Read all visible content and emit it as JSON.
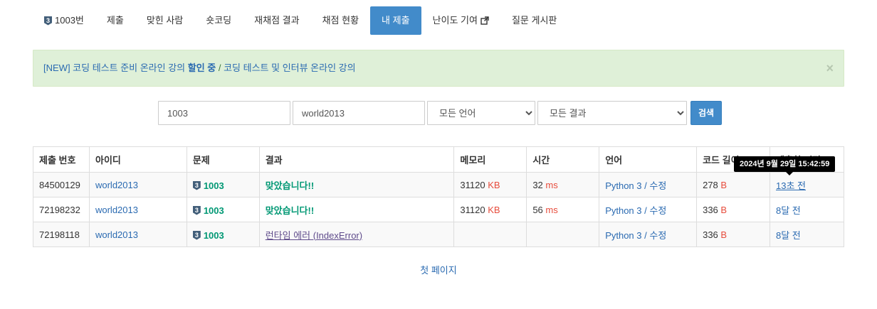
{
  "nav": {
    "problem_badge": "3",
    "problem_label": "1003번",
    "items": [
      "제출",
      "맞힌 사람",
      "숏코딩",
      "재채점 결과",
      "채점 현황",
      "내 제출",
      "난이도 기여",
      "질문 게시판"
    ]
  },
  "alert": {
    "prefix": "[NEW] 코딩 테스트 준비 온라인 강의 ",
    "bold": "할인 중",
    "sep": " / ",
    "link2": "코딩 테스트 및 인터뷰 온라인 강의",
    "close": "×"
  },
  "search": {
    "problem_id": "1003",
    "user_id": "world2013",
    "language": "모든 언어",
    "result": "모든 결과",
    "button": "검색"
  },
  "table": {
    "headers": [
      "제출 번호",
      "아이디",
      "문제",
      "결과",
      "메모리",
      "시간",
      "언어",
      "코드 길이",
      "제출한 시간"
    ],
    "rows": [
      {
        "id": "84500129",
        "user": "world2013",
        "badge": "3",
        "problem": "1003",
        "result": "맞았습니다!!",
        "memory": "31120",
        "memory_unit": "KB",
        "time": "32",
        "time_unit": "ms",
        "lang": "Python 3",
        "edit": "수정",
        "len": "278",
        "len_unit": "B",
        "submitted": "13초 전"
      },
      {
        "id": "72198232",
        "user": "world2013",
        "badge": "3",
        "problem": "1003",
        "result": "맞았습니다!!",
        "memory": "31120",
        "memory_unit": "KB",
        "time": "56",
        "time_unit": "ms",
        "lang": "Python 3",
        "edit": "수정",
        "len": "336",
        "len_unit": "B",
        "submitted": "8달 전"
      },
      {
        "id": "72198118",
        "user": "world2013",
        "badge": "3",
        "problem": "1003",
        "result": "런타임 에러 (IndexError)",
        "memory": "",
        "memory_unit": "",
        "time": "",
        "time_unit": "",
        "lang": "Python 3",
        "edit": "수정",
        "len": "336",
        "len_unit": "B",
        "submitted": "8달 전"
      }
    ]
  },
  "tooltip": "2024년 9월 29일 15:42:59",
  "pager": {
    "first": "첫 페이지"
  }
}
